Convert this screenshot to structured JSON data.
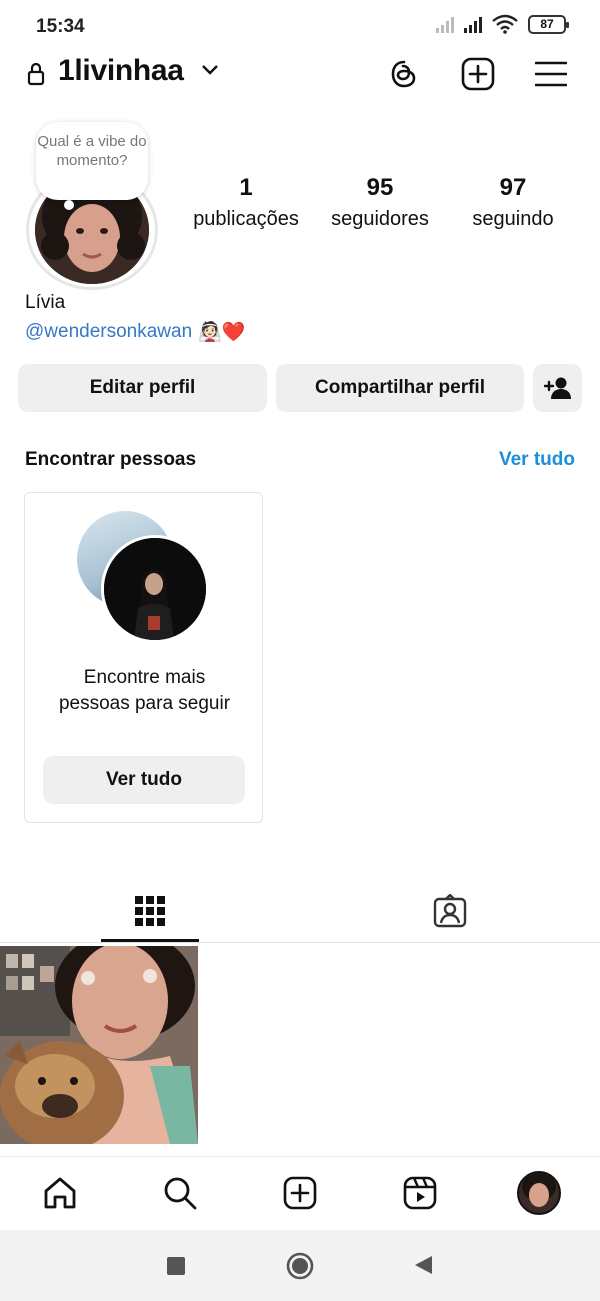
{
  "status_bar": {
    "time": "15:34",
    "battery": "87"
  },
  "header": {
    "username": "1livinhaa",
    "threads_label": "threads-icon",
    "create_label": "plus-square-icon",
    "menu_label": "hamburger-icon"
  },
  "profile": {
    "note": "Qual é a vibe do momento?",
    "stats": [
      {
        "value": "1",
        "label": "publicações"
      },
      {
        "value": "95",
        "label": "seguidores"
      },
      {
        "value": "97",
        "label": "seguindo"
      }
    ],
    "full_name": "Lívia",
    "handle": "@wendersonkawan",
    "handle_emoji": "👰🏻❤️"
  },
  "actions": {
    "edit_profile": "Editar perfil",
    "share_profile": "Compartilhar perfil"
  },
  "discover": {
    "title": "Encontrar pessoas",
    "see_all": "Ver tudo",
    "card_text": "Encontre mais pessoas para seguir",
    "card_button": "Ver tudo"
  },
  "tabs": [
    "grid-icon",
    "tagged-icon"
  ],
  "bottom_nav": [
    "home-icon",
    "search-icon",
    "create-icon",
    "reels-icon",
    "profile-avatar"
  ],
  "colors": {
    "link_blue": "#1a8fdc",
    "handle_blue": "#3578c6",
    "button_bg": "#efefef"
  }
}
